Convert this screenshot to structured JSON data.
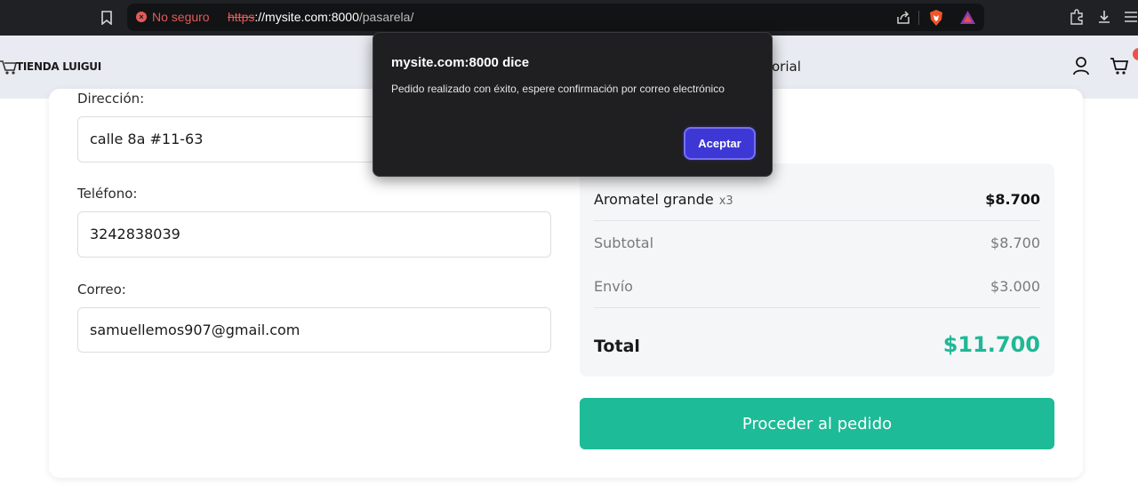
{
  "browser": {
    "security_warning": "No seguro",
    "url_scheme": "https",
    "url_host": "://mysite.com:8000",
    "url_path": "/pasarela/"
  },
  "site": {
    "logo_text": "TIENDA LUIGUI",
    "nav_fragment": "orial",
    "icons": [
      "user-icon",
      "cart-icon"
    ]
  },
  "form": {
    "direccion_label": "Dirección:",
    "direccion_value": "calle 8a #11-63",
    "telefono_label": "Teléfono:",
    "telefono_value": "3242838039",
    "correo_label": "Correo:",
    "correo_value": "samuellemos907@gmail.com"
  },
  "summary": {
    "item_name": "Aromatel grande",
    "item_qty": "x3",
    "item_price": "$8.700",
    "subtotal_label": "Subtotal",
    "subtotal_value": "$8.700",
    "envio_label": "Envío",
    "envio_value": "$3.000",
    "total_label": "Total",
    "total_value": "$11.700"
  },
  "proceed_button": "Proceder al pedido",
  "dialog": {
    "title": "mysite.com:8000 dice",
    "message": "Pedido realizado con éxito, espere confirmación por correo electrónico",
    "button": "Aceptar"
  },
  "colors": {
    "accent_green": "#1dbb97",
    "dialog_button": "#3d37d6",
    "warning_red": "#e35a5a"
  }
}
